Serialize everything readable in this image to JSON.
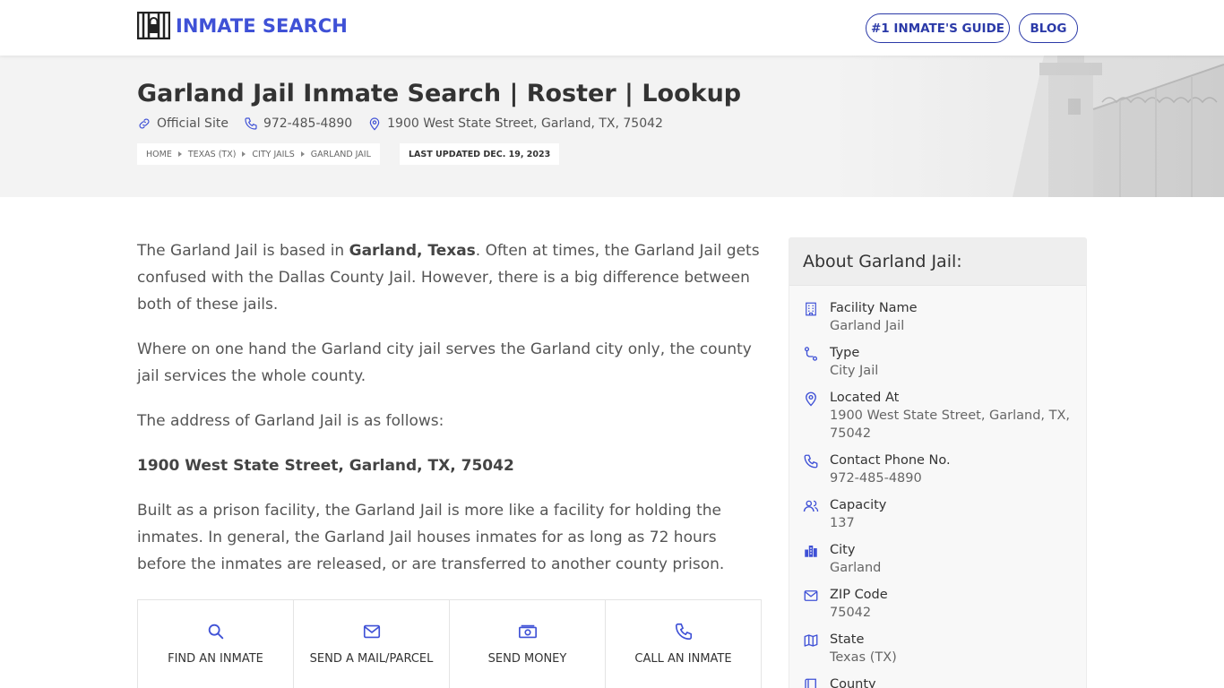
{
  "brand": {
    "name": "INMATE SEARCH",
    "color": "#3f51d6"
  },
  "nav": {
    "guide_label": "#1 INMATE'S GUIDE",
    "blog_label": "BLOG"
  },
  "hero": {
    "title": "Garland Jail Inmate Search | Roster | Lookup",
    "official_site": "Official Site",
    "phone": "972-485-4890",
    "address": "1900 West State Street, Garland, TX, 75042",
    "breadcrumbs": [
      "HOME",
      "TEXAS (TX)",
      "CITY JAILS",
      "GARLAND JAIL"
    ],
    "last_updated": "LAST UPDATED DEC. 19, 2023"
  },
  "content": {
    "p1_a": "The Garland Jail is based in ",
    "p1_b": "Garland, Texas",
    "p1_c": ". Often at times, the Garland Jail gets confused with the Dallas County Jail. However, there is a big difference between both of these jails.",
    "p2": "Where on one hand the Garland city jail serves the Garland city only, the county jail services the whole county.",
    "p3": "The address of Garland Jail is as follows:",
    "p4": "1900 West State Street, Garland, TX, 75042",
    "p5": "Built as a prison facility, the Garland Jail is more like a facility for holding the inmates. In general, the Garland Jail houses inmates for as long as 72 hours before the inmates are released, or are transferred to another county prison."
  },
  "actions": [
    {
      "label": "FIND AN INMATE",
      "icon": "search-icon"
    },
    {
      "label": "SEND A MAIL/PARCEL",
      "icon": "mail-icon"
    },
    {
      "label": "SEND MONEY",
      "icon": "money-icon"
    },
    {
      "label": "CALL AN INMATE",
      "icon": "phone-icon"
    }
  ],
  "sidebar": {
    "title": "About Garland Jail:",
    "facts": [
      {
        "label": "Facility Name",
        "value": "Garland Jail",
        "icon": "building-icon"
      },
      {
        "label": "Type",
        "value": "City Jail",
        "icon": "route-icon"
      },
      {
        "label": "Located At",
        "value": "1900 West State Street, Garland, TX, 75042",
        "icon": "map-pin-icon"
      },
      {
        "label": "Contact Phone No.",
        "value": "972-485-4890",
        "icon": "phone-icon"
      },
      {
        "label": "Capacity",
        "value": "137",
        "icon": "users-icon"
      },
      {
        "label": "City",
        "value": "Garland",
        "icon": "city-icon"
      },
      {
        "label": "ZIP Code",
        "value": "75042",
        "icon": "mail-icon"
      },
      {
        "label": "State",
        "value": "Texas (TX)",
        "icon": "map-icon"
      },
      {
        "label": "County",
        "value": "",
        "icon": "book-icon"
      }
    ]
  }
}
